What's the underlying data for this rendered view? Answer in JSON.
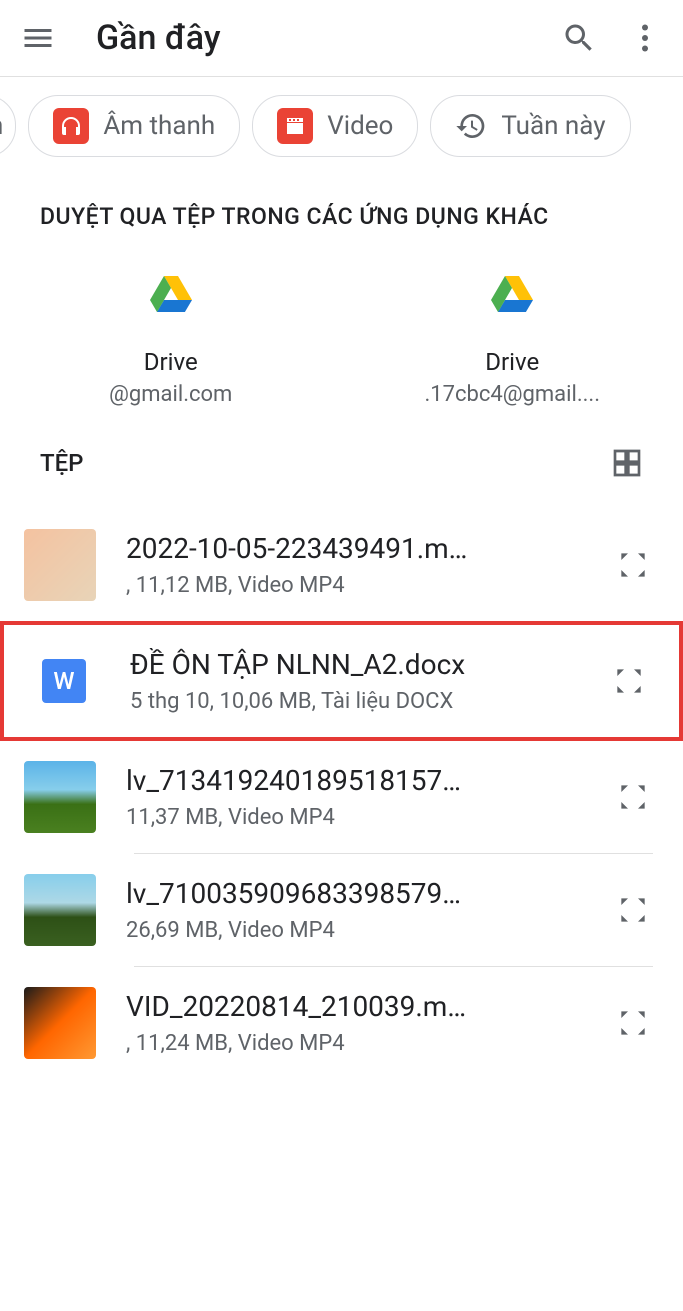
{
  "header": {
    "title": "Gần đây"
  },
  "chips": [
    {
      "label": "Âm thanh",
      "icon": "audio"
    },
    {
      "label": "Video",
      "icon": "video"
    },
    {
      "label": "Tuần này",
      "icon": "history"
    }
  ],
  "browse": {
    "title": "DUYỆT QUA TỆP TRONG CÁC ỨNG DỤNG KHÁC",
    "apps": [
      {
        "name": "Drive",
        "email": "@gmail.com"
      },
      {
        "name": "Drive",
        "email": ".17cbc4@gmail...."
      }
    ]
  },
  "files": {
    "title": "TỆP",
    "items": [
      {
        "name": "2022-10-05-223439491.m…",
        "meta": ", 11,12 MB, Video MP4",
        "thumb": "video1"
      },
      {
        "name": "ĐỀ ÔN TẬP NLNN_A2.docx",
        "meta": "5 thg 10, 10,06 MB, Tài liệu DOCX",
        "thumb": "word",
        "highlighted": true
      },
      {
        "name": "lv_713419240189518157…",
        "meta": "11,37 MB, Video MP4",
        "thumb": "video2"
      },
      {
        "name": "lv_710035909683398579…",
        "meta": "26,69 MB, Video MP4",
        "thumb": "video3"
      },
      {
        "name": "VID_20220814_210039.m…",
        "meta": ", 11,24 MB, Video MP4",
        "thumb": "video4"
      }
    ]
  }
}
